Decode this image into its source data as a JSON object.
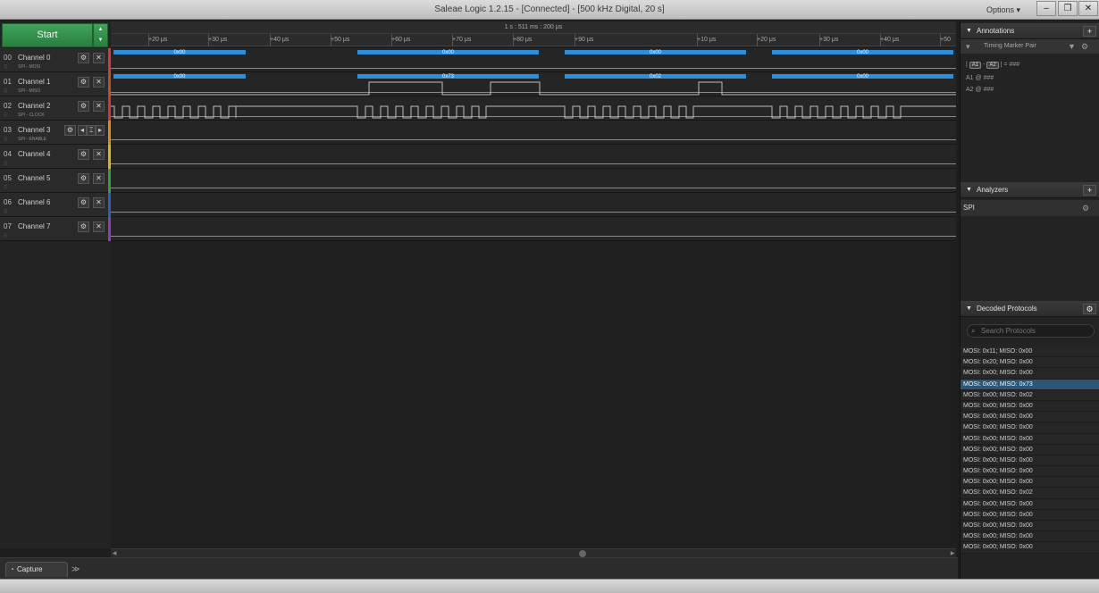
{
  "window": {
    "title": "Saleae Logic 1.2.15 - [Connected] - [500 kHz Digital, 20 s]",
    "options_label": "Options ▾"
  },
  "controls": {
    "start_label": "Start"
  },
  "channels": [
    {
      "num": "00",
      "name": "Channel 0",
      "sub": "SPI - MOSI",
      "color": "#d23b3b"
    },
    {
      "num": "01",
      "name": "Channel 1",
      "sub": "SPI - MISO",
      "color": "#b4522a"
    },
    {
      "num": "02",
      "name": "Channel 2",
      "sub": "SPI - CLOCK",
      "color": "#d8342f"
    },
    {
      "num": "03",
      "name": "Channel 3",
      "sub": "SPI - ENABLE",
      "color": "#e08a1c"
    },
    {
      "num": "04",
      "name": "Channel 4",
      "sub": "",
      "color": "#d6b51f"
    },
    {
      "num": "05",
      "name": "Channel 5",
      "sub": "",
      "color": "#3a9a3f"
    },
    {
      "num": "06",
      "name": "Channel 6",
      "sub": "",
      "color": "#2e5fb8"
    },
    {
      "num": "07",
      "name": "Channel 7",
      "sub": "",
      "color": "#8a3fb8"
    }
  ],
  "ruler": {
    "scale": "1 s : 511 ms : 200 μs",
    "ticks": [
      "+20 μs",
      "+30 μs",
      "+40 μs",
      "+50 μs",
      "+60 μs",
      "+70 μs",
      "+80 μs",
      "+90 μs",
      "+10 μs",
      "+20 μs",
      "+30 μs",
      "+40 μs",
      "+50"
    ]
  },
  "mosi_bytes": [
    "0x00",
    "0x00",
    "0x00",
    "0x00"
  ],
  "miso_bytes": [
    "0x00",
    "0x73",
    "0x02",
    "0x00"
  ],
  "bottom": {
    "capture_label": "Capture",
    "more_label": "≫"
  },
  "annotations": {
    "header": "Annotations",
    "marker_pair": "Timing Marker Pair",
    "diff_prefix": "|",
    "a1": "A1",
    "a2": "A2",
    "diff_suffix": "| = ###",
    "a1_line": "@  ###",
    "a2_line": "@  ###",
    "a_sep": "-"
  },
  "analyzers": {
    "header": "Analyzers",
    "items": [
      "SPI"
    ]
  },
  "decoded": {
    "header": "Decoded Protocols",
    "search_placeholder": "Search Protocols",
    "rows": [
      "MOSI: 0x11;  MISO: 0x00",
      "MOSI: 0x20;  MISO: 0x00",
      "MOSI: 0x00;  MISO: 0x00",
      "MOSI: 0x00;  MISO: 0x73",
      "MOSI: 0x00;  MISO: 0x02",
      "MOSI: 0x00;  MISO: 0x00",
      "MOSI: 0x00;  MISO: 0x00",
      "MOSI: 0x00;  MISO: 0x00",
      "MOSI: 0x00;  MISO: 0x00",
      "MOSI: 0x00;  MISO: 0x00",
      "MOSI: 0x00;  MISO: 0x00",
      "MOSI: 0x00;  MISO: 0x00",
      "MOSI: 0x00;  MISO: 0x00",
      "MOSI: 0x00;  MISO: 0x02",
      "MOSI: 0x00;  MISO: 0x00",
      "MOSI: 0x00;  MISO: 0x00",
      "MOSI: 0x00;  MISO: 0x00",
      "MOSI: 0x00;  MISO: 0x00",
      "MOSI: 0x00;  MISO: 0x00"
    ],
    "selected_index": 3
  }
}
